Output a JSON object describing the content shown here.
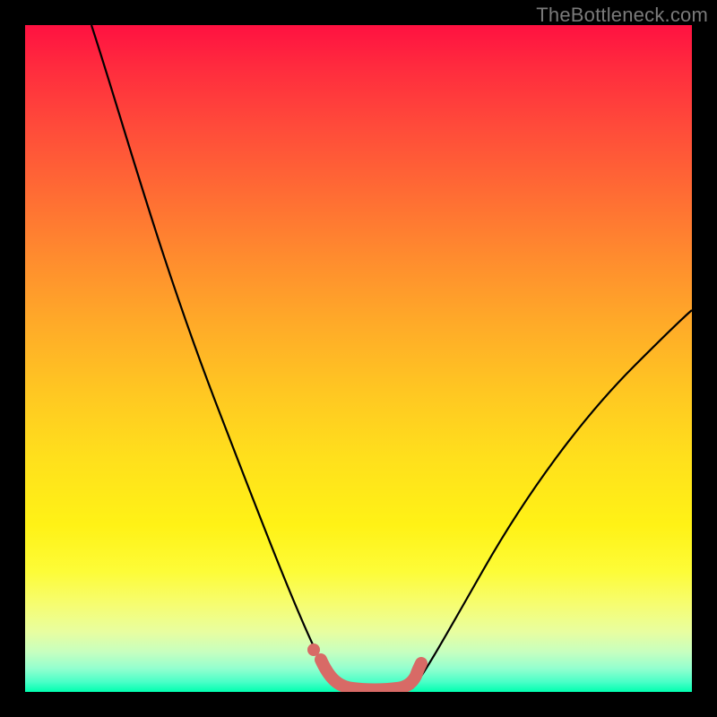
{
  "watermark": "TheBottleneck.com",
  "chart_data": {
    "type": "line",
    "title": "",
    "xlabel": "",
    "ylabel": "",
    "xlim": [
      0,
      100
    ],
    "ylim": [
      0,
      100
    ],
    "grid": false,
    "series": [
      {
        "name": "left-curve",
        "color": "#000000",
        "x": [
          10,
          15,
          20,
          25,
          30,
          35,
          40,
          44,
          47
        ],
        "values": [
          100,
          85,
          69,
          52,
          36,
          22,
          11,
          4,
          1
        ]
      },
      {
        "name": "right-curve",
        "color": "#000000",
        "x": [
          58,
          62,
          68,
          75,
          83,
          92,
          100
        ],
        "values": [
          1,
          5,
          13,
          24,
          36,
          48,
          58
        ]
      },
      {
        "name": "bottom-accent",
        "color": "#d86a66",
        "x": [
          44,
          47,
          49,
          52,
          55,
          57,
          58,
          59
        ],
        "values": [
          4.5,
          1.2,
          0.7,
          0.5,
          0.5,
          0.8,
          1.6,
          3.6
        ]
      },
      {
        "name": "accent-dot",
        "color": "#d86a66",
        "x": [
          43
        ],
        "values": [
          6.4
        ]
      }
    ]
  }
}
